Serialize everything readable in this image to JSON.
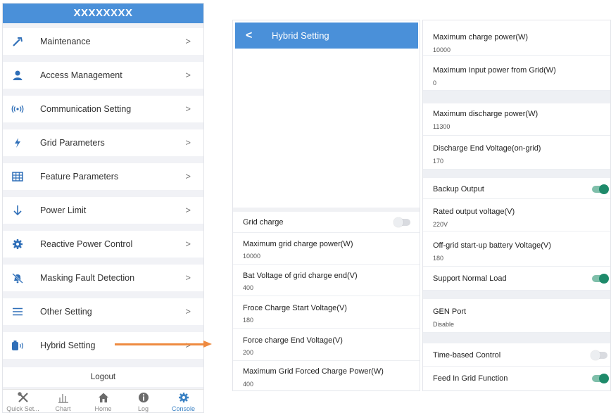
{
  "console": {
    "title": "XXXXXXXX",
    "menu": [
      {
        "label": "Maintenance",
        "icon": "hammer-icon"
      },
      {
        "label": "Access Management",
        "icon": "user-icon"
      },
      {
        "label": "Communication Setting",
        "icon": "signal-icon"
      },
      {
        "label": "Grid Parameters",
        "icon": "lightning-icon"
      },
      {
        "label": "Feature Parameters",
        "icon": "grid-table-icon"
      },
      {
        "label": "Power Limit",
        "icon": "arrow-down-icon"
      },
      {
        "label": "Reactive Power Control",
        "icon": "gear-icon"
      },
      {
        "label": "Masking Fault Detection",
        "icon": "bell-off-icon"
      },
      {
        "label": "Other Setting",
        "icon": "menu-lines-icon"
      },
      {
        "label": "Hybrid Setting",
        "icon": "battery-icon"
      }
    ],
    "chevron": ">",
    "logout": "Logout",
    "tabs": [
      {
        "label": "Quick Set...",
        "icon": "tools-icon"
      },
      {
        "label": "Chart",
        "icon": "bar-chart-icon"
      },
      {
        "label": "Home",
        "icon": "home-icon"
      },
      {
        "label": "Log",
        "icon": "info-icon"
      },
      {
        "label": "Console",
        "icon": "gear-icon",
        "active": true
      }
    ],
    "accent": "#4a90d9"
  },
  "hybrid_left": {
    "back": "<",
    "title": "Hybrid Setting",
    "rows": [
      {
        "title": "Grid charge",
        "toggle": "off"
      },
      {
        "title": "Maximum grid charge power(W)",
        "value": "10000"
      },
      {
        "title": "Bat Voltage of grid charge end(V)",
        "value": "400"
      },
      {
        "title": "Froce Charge Start Voltage(V)",
        "value": "180"
      },
      {
        "title": "Force charge End Voltage(V)",
        "value": "200"
      },
      {
        "title": "Maximum Grid Forced Charge Power(W)",
        "value": "400"
      }
    ]
  },
  "hybrid_right": {
    "rows": [
      {
        "title": "Maximum charge power(W)",
        "value": "10000"
      },
      {
        "title": "Maximum Input power from Grid(W)",
        "value": "0"
      },
      {
        "title": "Maximum discharge power(W)",
        "value": "11300"
      },
      {
        "title": "Discharge End Voltage(on-grid)",
        "value": "170"
      },
      {
        "title": "Backup Output",
        "toggle": "on"
      },
      {
        "title": "Rated output voltage(V)",
        "value": "220V"
      },
      {
        "title": "Off-grid start-up battery Voltage(V)",
        "value": "180"
      },
      {
        "title": "Support Normal Load",
        "toggle": "on"
      },
      {
        "title": "GEN Port",
        "value": "Disable"
      },
      {
        "title": "Time-based Control",
        "toggle": "off"
      },
      {
        "title": "Feed In Grid Function",
        "toggle": "on"
      }
    ]
  },
  "colors": {
    "arrow": "#ee8a40",
    "toggle_on": "#1e8a6a",
    "icon_blue": "#2f6fb8"
  }
}
